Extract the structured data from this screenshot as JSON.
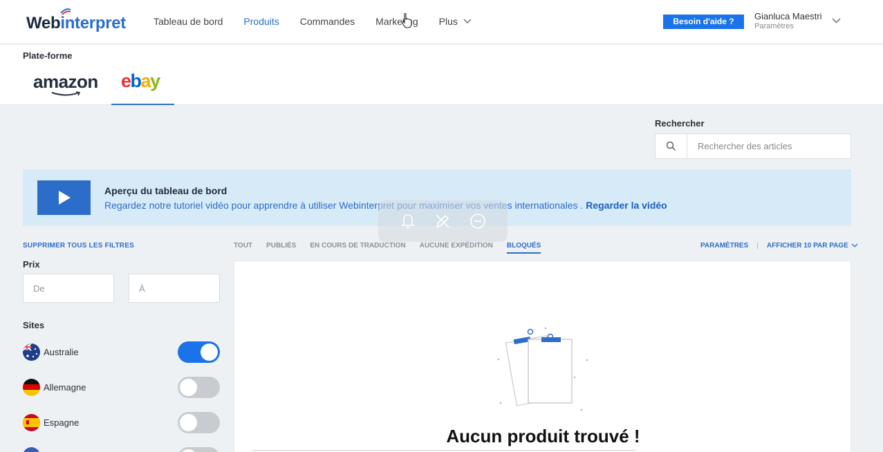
{
  "header": {
    "logo_a": "Web",
    "logo_b": "interpret",
    "nav": [
      "Tableau de bord",
      "Produits",
      "Commandes",
      "Marketing"
    ],
    "nav_more": "Plus",
    "help_button": "Besoin d'aide ?",
    "user_name": "Gianluca Maestri",
    "user_sub": "Paramètres"
  },
  "platform": {
    "label": "Plate-forme",
    "amazon": "amazon",
    "ebay": [
      "e",
      "b",
      "a",
      "y"
    ]
  },
  "search": {
    "label": "Rechercher",
    "placeholder": "Rechercher des articles"
  },
  "banner": {
    "title": "Aperçu du tableau de bord",
    "text": "Regardez notre tutoriel vidéo pour apprendre à utiliser Webinterpret pour maximiser vos ventes internationales .",
    "link": "Regarder la vidéo"
  },
  "filters": {
    "clear": "SUPPRIMER TOUS LES FILTRES",
    "price_label": "Prix",
    "price_from": "De",
    "price_to": "À",
    "sites_label": "Sites",
    "sites": [
      {
        "name": "Australie",
        "enabled": true
      },
      {
        "name": "Allemagne",
        "enabled": false
      },
      {
        "name": "Espagne",
        "enabled": false
      }
    ]
  },
  "tabs": [
    "TOUT",
    "PUBLIÉS",
    "EN COURS DE TRADUCTION",
    "AUCUNE EXPÉDITION",
    "BLOQUÉS"
  ],
  "active_tab": "BLOQUÉS",
  "settings_link": "PARAMÈTRES",
  "per_page": "AFFICHER 10 PAR PAGE",
  "empty_message": "Aucun produit trouvé !",
  "colors": {
    "accent": "#2b6dc8",
    "button": "#1a73e8",
    "banner_bg": "#d7eaf8"
  }
}
